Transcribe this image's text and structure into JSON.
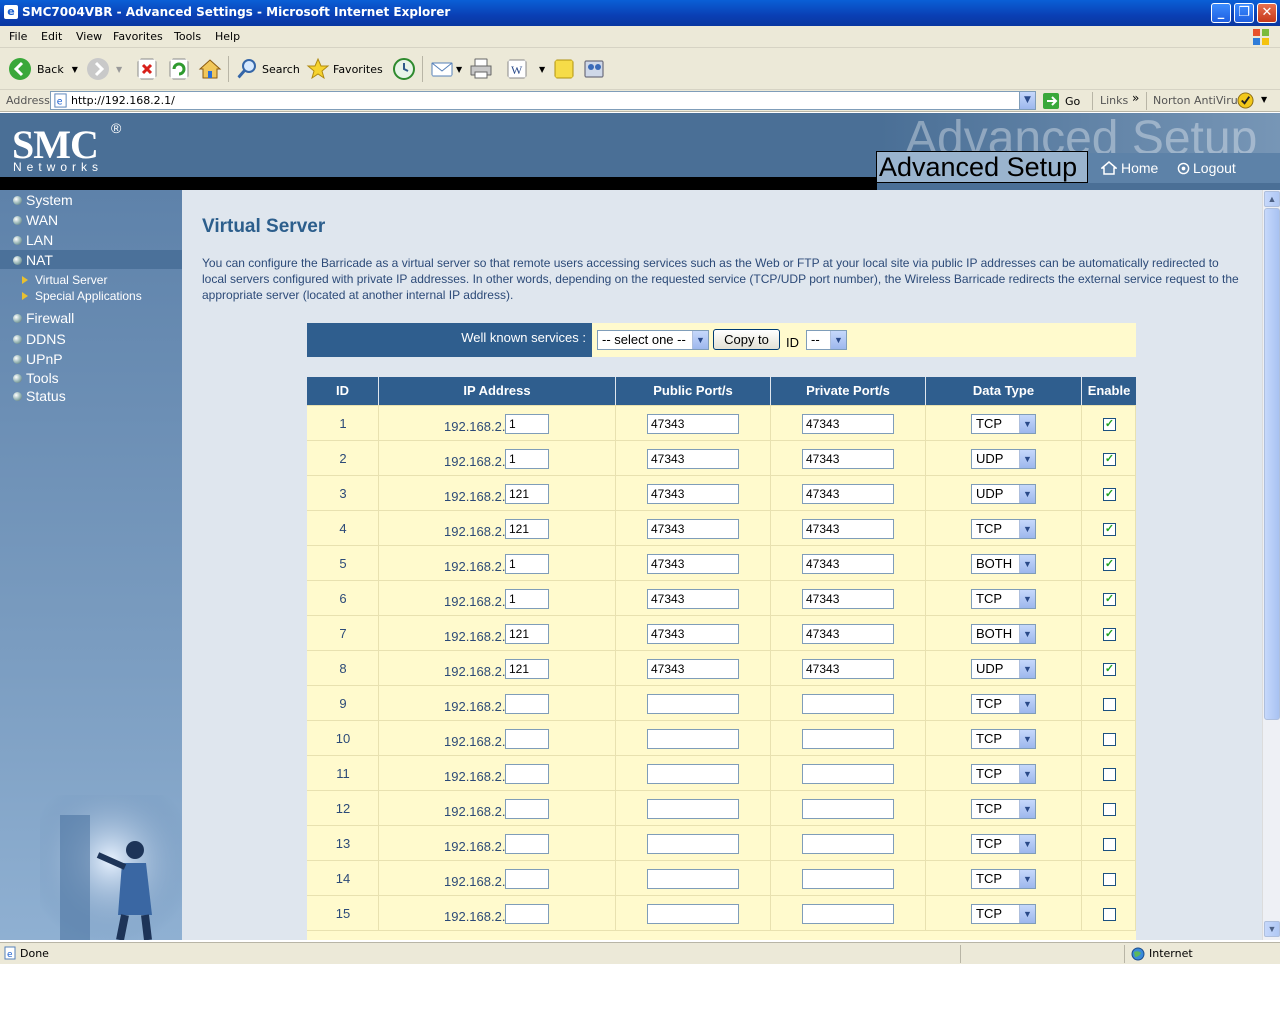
{
  "window": {
    "title": "SMC7004VBR - Advanced Settings - Microsoft Internet Explorer",
    "minimize": "_",
    "maximize": "❐",
    "close": "✕"
  },
  "menu": [
    "File",
    "Edit",
    "View",
    "Favorites",
    "Tools",
    "Help"
  ],
  "toolbar": {
    "back": "Back",
    "search": "Search",
    "favorites": "Favorites"
  },
  "address": {
    "label": "Address",
    "url": "http://192.168.2.1/",
    "go": "Go",
    "links": "Links",
    "norton": "Norton AntiVirus"
  },
  "banner": {
    "logo": "SMC",
    "logo_reg": "®",
    "logo_sub": "Networks",
    "ghost": "Advanced Setup",
    "title": "Advanced Setup",
    "home": "Home",
    "logout": "Logout"
  },
  "sidebar": {
    "items": [
      {
        "label": "System"
      },
      {
        "label": "WAN"
      },
      {
        "label": "LAN"
      },
      {
        "label": "NAT"
      },
      {
        "label": "Firewall"
      },
      {
        "label": "DDNS"
      },
      {
        "label": "UPnP"
      },
      {
        "label": "Tools"
      },
      {
        "label": "Status"
      }
    ],
    "sub_items": [
      {
        "label": "Virtual Server"
      },
      {
        "label": "Special Applications"
      }
    ]
  },
  "page": {
    "title": "Virtual Server",
    "description": "You can configure the Barricade as a virtual server so that remote users accessing services such as the Web or FTP at your local site via public IP addresses can be automatically redirected to local servers configured with private IP addresses. In other words, depending on the requested service (TCP/UDP port number), the Wireless Barricade redirects the external service request to the appropriate server (located at another internal IP address).",
    "well_known_label": "Well known services :",
    "service_select": "-- select one --",
    "copy_button": "Copy to",
    "id_label": "ID",
    "id_select": "--"
  },
  "table": {
    "headers": [
      "ID",
      "IP Address",
      "Public Port/s",
      "Private Port/s",
      "Data Type",
      "Enable"
    ],
    "ip_prefix": "192.168.2.",
    "rows": [
      {
        "id": "1",
        "ip": "1",
        "public": "47343",
        "private": "47343",
        "type": "TCP",
        "enabled": true
      },
      {
        "id": "2",
        "ip": "1",
        "public": "47343",
        "private": "47343",
        "type": "UDP",
        "enabled": true
      },
      {
        "id": "3",
        "ip": "121",
        "public": "47343",
        "private": "47343",
        "type": "UDP",
        "enabled": true
      },
      {
        "id": "4",
        "ip": "121",
        "public": "47343",
        "private": "47343",
        "type": "TCP",
        "enabled": true
      },
      {
        "id": "5",
        "ip": "1",
        "public": "47343",
        "private": "47343",
        "type": "BOTH",
        "enabled": true
      },
      {
        "id": "6",
        "ip": "1",
        "public": "47343",
        "private": "47343",
        "type": "TCP",
        "enabled": true
      },
      {
        "id": "7",
        "ip": "121",
        "public": "47343",
        "private": "47343",
        "type": "BOTH",
        "enabled": true
      },
      {
        "id": "8",
        "ip": "121",
        "public": "47343",
        "private": "47343",
        "type": "UDP",
        "enabled": true
      },
      {
        "id": "9",
        "ip": "",
        "public": "",
        "private": "",
        "type": "TCP",
        "enabled": false
      },
      {
        "id": "10",
        "ip": "",
        "public": "",
        "private": "",
        "type": "TCP",
        "enabled": false
      },
      {
        "id": "11",
        "ip": "",
        "public": "",
        "private": "",
        "type": "TCP",
        "enabled": false
      },
      {
        "id": "12",
        "ip": "",
        "public": "",
        "private": "",
        "type": "TCP",
        "enabled": false
      },
      {
        "id": "13",
        "ip": "",
        "public": "",
        "private": "",
        "type": "TCP",
        "enabled": false
      },
      {
        "id": "14",
        "ip": "",
        "public": "",
        "private": "",
        "type": "TCP",
        "enabled": false
      },
      {
        "id": "15",
        "ip": "",
        "public": "",
        "private": "",
        "type": "TCP",
        "enabled": false
      }
    ]
  },
  "status": {
    "text": "Done",
    "zone": "Internet"
  },
  "colors": {
    "header_blue": "#2f5e8e",
    "row_yellow": "#fffacd",
    "title_blue": "#2c5e8c",
    "check_green": "#21a121"
  }
}
